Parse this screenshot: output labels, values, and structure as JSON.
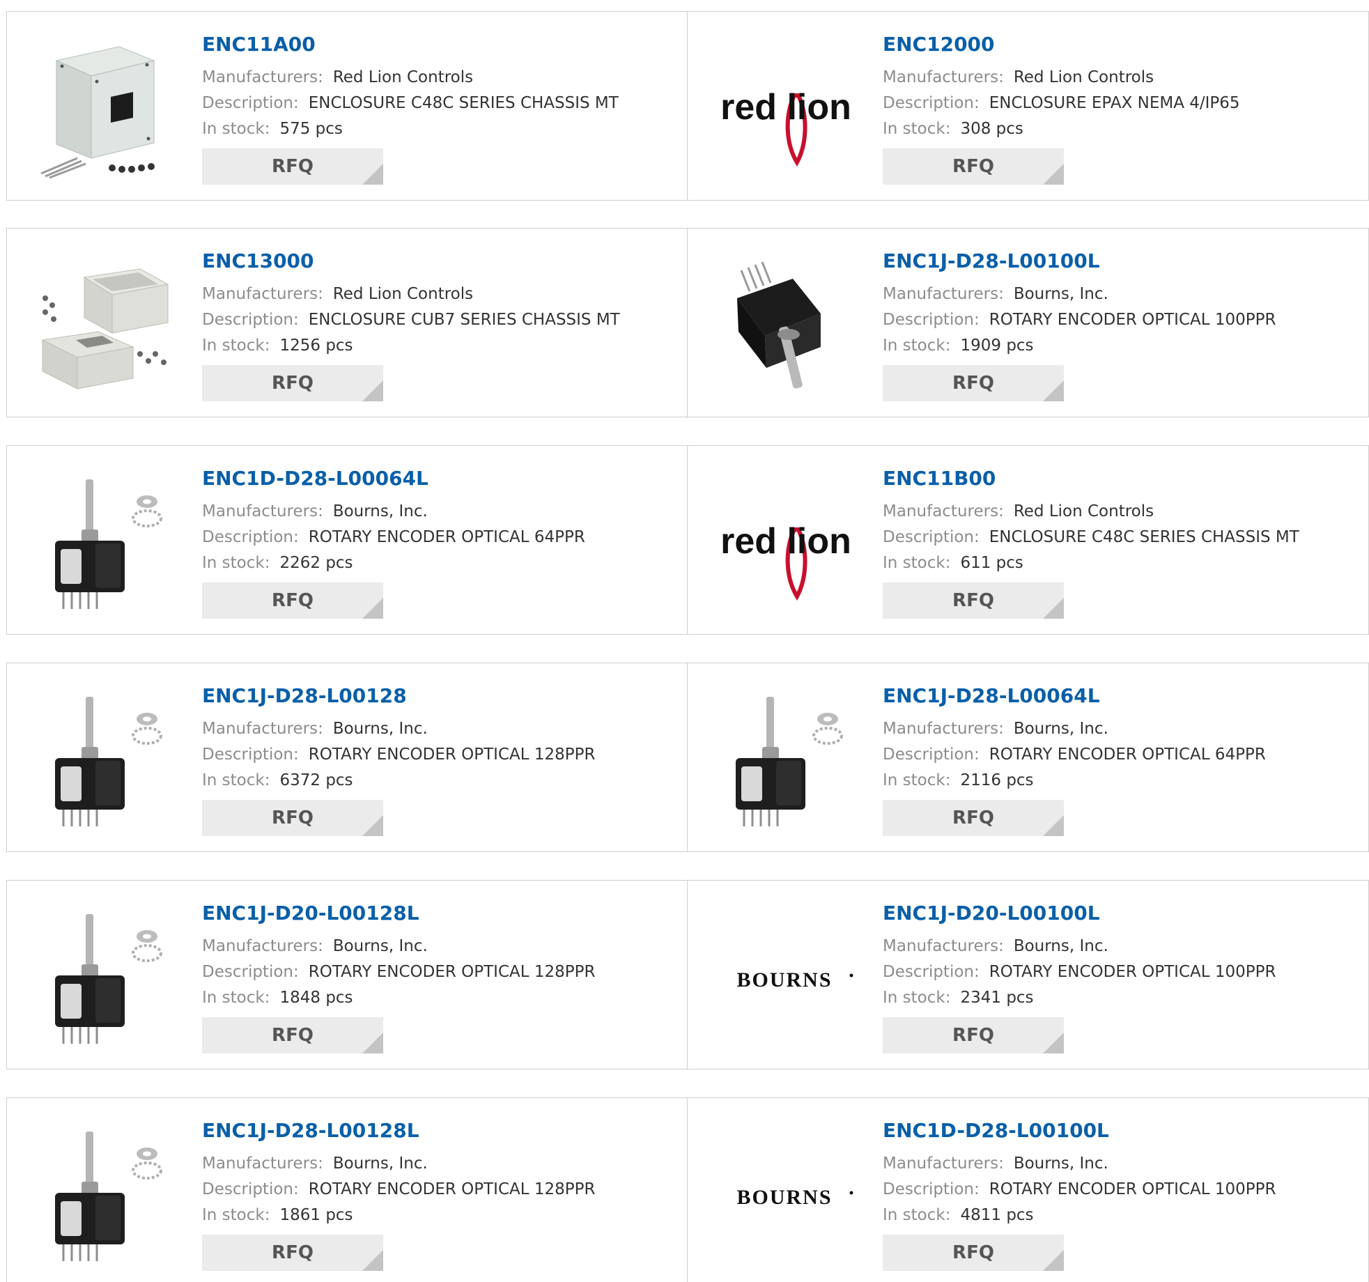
{
  "labels": {
    "manufacturers": "Manufacturers:",
    "description": "Description:",
    "in_stock": "In stock:",
    "rfq": "RFQ"
  },
  "products": [
    {
      "part": "ENC11A00",
      "manufacturer": "Red Lion Controls",
      "description": "ENCLOSURE C48C SERIES CHASSIS MT",
      "stock": "575 pcs",
      "image": "enclosure-box-image"
    },
    {
      "part": "ENC12000",
      "manufacturer": "Red Lion Controls",
      "description": "ENCLOSURE EPAX NEMA 4/IP65",
      "stock": "308 pcs",
      "image": "red-lion-logo",
      "logo_text": "red lion"
    },
    {
      "part": "ENC13000",
      "manufacturer": "Red Lion Controls",
      "description": "ENCLOSURE CUB7 SERIES CHASSIS MT",
      "stock": "1256 pcs",
      "image": "enclosure-open-image"
    },
    {
      "part": "ENC1J-D28-L00100L",
      "manufacturer": "Bourns, Inc.",
      "description": "ROTARY ENCODER OPTICAL 100PPR",
      "stock": "1909 pcs",
      "image": "black-encoder-image"
    },
    {
      "part": "ENC1D-D28-L00064L",
      "manufacturer": "Bourns, Inc.",
      "description": "ROTARY ENCODER OPTICAL 64PPR",
      "stock": "2262 pcs",
      "image": "encoder-with-shaft-image"
    },
    {
      "part": "ENC11B00",
      "manufacturer": "Red Lion Controls",
      "description": "ENCLOSURE C48C SERIES CHASSIS MT",
      "stock": "611 pcs",
      "image": "red-lion-logo",
      "logo_text": "red lion"
    },
    {
      "part": "ENC1J-D28-L00128",
      "manufacturer": "Bourns, Inc.",
      "description": "ROTARY ENCODER OPTICAL 128PPR",
      "stock": "6372 pcs",
      "image": "encoder-with-shaft-image"
    },
    {
      "part": "ENC1J-D28-L00064L",
      "manufacturer": "Bourns, Inc.",
      "description": "ROTARY ENCODER OPTICAL 64PPR",
      "stock": "2116 pcs",
      "image": "encoder-with-shaft-image"
    },
    {
      "part": "ENC1J-D20-L00128L",
      "manufacturer": "Bourns, Inc.",
      "description": "ROTARY ENCODER OPTICAL 128PPR",
      "stock": "1848 pcs",
      "image": "encoder-with-shaft-image"
    },
    {
      "part": "ENC1J-D20-L00100L",
      "manufacturer": "Bourns, Inc.",
      "description": "ROTARY ENCODER OPTICAL 100PPR",
      "stock": "2341 pcs",
      "image": "bourns-logo",
      "logo_text": "BOURNS"
    },
    {
      "part": "ENC1J-D28-L00128L",
      "manufacturer": "Bourns, Inc.",
      "description": "ROTARY ENCODER OPTICAL 128PPR",
      "stock": "1861 pcs",
      "image": "encoder-with-shaft-image"
    },
    {
      "part": "ENC1D-D28-L00100L",
      "manufacturer": "Bourns, Inc.",
      "description": "ROTARY ENCODER OPTICAL 100PPR",
      "stock": "4811 pcs",
      "image": "bourns-logo",
      "logo_text": "BOURNS"
    }
  ],
  "colors": {
    "part_link": "#0a5fa8",
    "label": "#8c8c8c",
    "value": "#333333",
    "rfq_bg": "#ebebeb",
    "border": "#cfcfcf",
    "red_lion_red": "#c8102e"
  }
}
